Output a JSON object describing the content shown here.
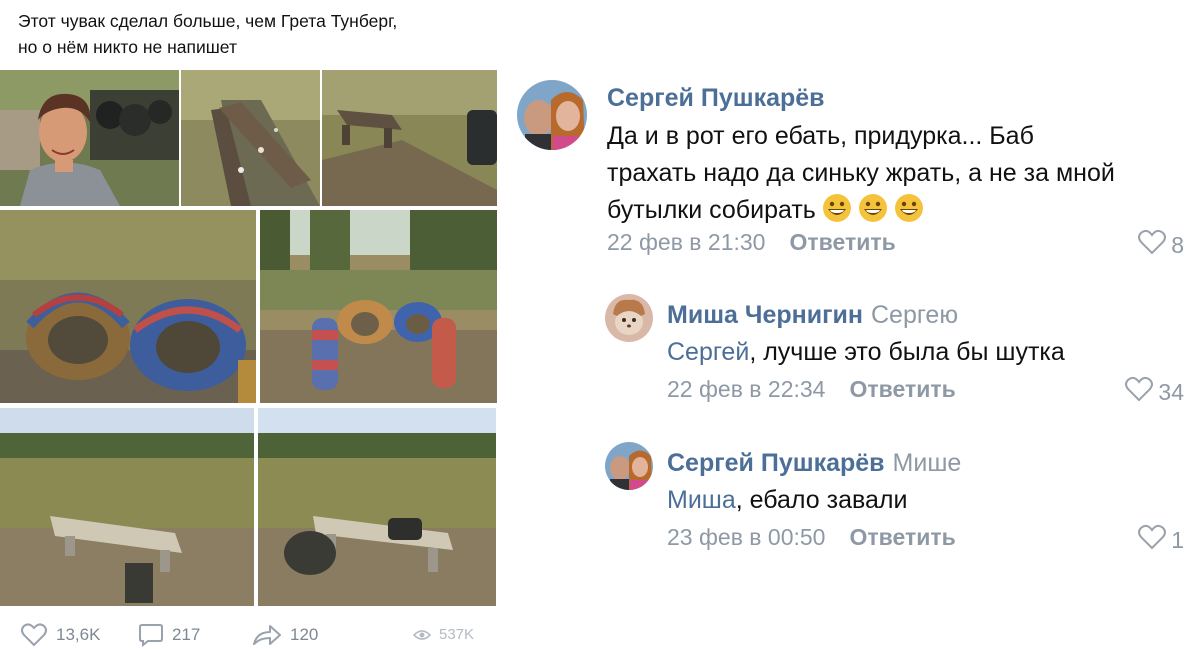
{
  "post": {
    "text_line1": "Этот чувак сделал больше, чем Грета Тунберг,",
    "text_line2": "но о нём никто не напишет",
    "likes": "13,6K",
    "comments": "217",
    "shares": "120",
    "views": "537K",
    "icons": {
      "like": "heart-icon",
      "comment": "comment-icon",
      "share": "share-arrow-icon",
      "views": "eye-icon"
    }
  },
  "comments": [
    {
      "author": "Сергей Пушкарёв",
      "reply_to": "",
      "text_lines": [
        "Да и в рот его ебать, придурка... Баб",
        "трахать надо да синьку жрать, а не за мной",
        "бутылки собирать"
      ],
      "emoji": [
        "grinning-face-emoji",
        "grinning-face-emoji",
        "grinning-face-emoji"
      ],
      "date": "22 фев в 21:30",
      "reply_label": "Ответить",
      "likes": "8"
    },
    {
      "author": "Миша Чернигин",
      "reply_to": "Сергею",
      "mention": "Сергей",
      "text": ", лучше это была бы шутка",
      "date": "22 фев в 22:34",
      "reply_label": "Ответить",
      "likes": "34"
    },
    {
      "author": "Сергей Пушкарёв",
      "reply_to": "Мише",
      "mention": "Миша",
      "text": ", ебало завали",
      "date": "23 фев в 00:50",
      "reply_label": "Ответить",
      "likes": "1"
    }
  ],
  "colors": {
    "link": "#4c6f98",
    "muted": "#8e99a5",
    "text": "#111111"
  }
}
